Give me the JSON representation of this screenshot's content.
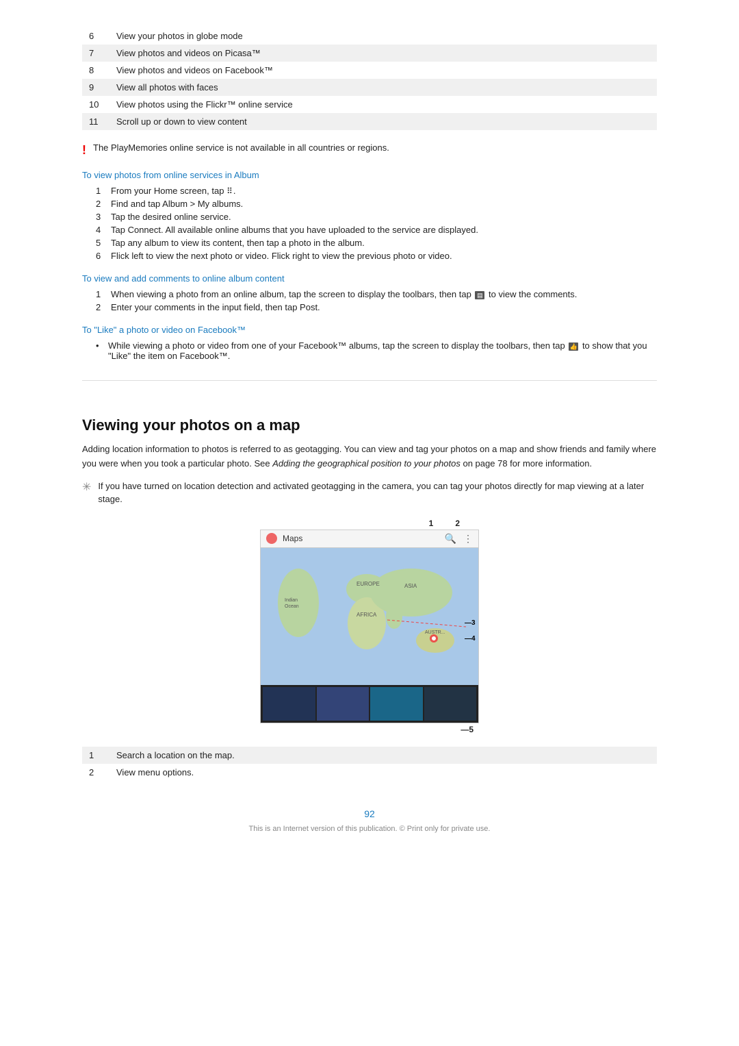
{
  "table_rows": [
    {
      "num": "6",
      "text": "View your photos in globe mode",
      "shaded": false
    },
    {
      "num": "7",
      "text": "View photos and videos on Picasa™",
      "shaded": true
    },
    {
      "num": "8",
      "text": "View photos and videos on Facebook™",
      "shaded": false
    },
    {
      "num": "9",
      "text": "View all photos with faces",
      "shaded": true
    },
    {
      "num": "10",
      "text": "View photos using the Flickr™ online service",
      "shaded": false
    },
    {
      "num": "11",
      "text": "Scroll up or down to view content",
      "shaded": true
    }
  ],
  "warning_note": "The PlayMemories online service is not available in all countries or regions.",
  "section1_heading": "To view photos from online services in Album",
  "section1_steps": [
    {
      "num": "1",
      "text": "From your Home screen, tap ⠿."
    },
    {
      "num": "2",
      "text": "Find and tap Album > My albums."
    },
    {
      "num": "3",
      "text": "Tap the desired online service."
    },
    {
      "num": "4",
      "text": "Tap Connect. All available online albums that you have uploaded to the service are displayed."
    },
    {
      "num": "5",
      "text": "Tap any album to view its content, then tap a photo in the album."
    },
    {
      "num": "6",
      "text": "Flick left to view the next photo or video. Flick right to view the previous photo or video."
    }
  ],
  "section2_heading": "To view and add comments to online album content",
  "section2_steps": [
    {
      "num": "1",
      "text": "When viewing a photo from an online album, tap the screen to display the toolbars, then tap  to view the comments."
    },
    {
      "num": "2",
      "text": "Enter your comments in the input field, then tap Post."
    }
  ],
  "section3_heading": "To \"Like\" a photo or video on Facebook™",
  "section3_bullets": [
    "While viewing a photo or video from one of your Facebook™ albums, tap the screen to display the toolbars, then tap  to show that you \"Like\" the item on Facebook™."
  ],
  "main_title": "Viewing your photos on a map",
  "main_para": "Adding location information to photos is referred to as geotagging. You can view and tag your photos on a map and show friends and family where you were when you took a particular photo. See Adding the geographical position to your photos on page 78 for more information.",
  "tip_text": "If you have turned on location detection and activated geotagging in the camera, you can tag your photos directly for map viewing at a later stage.",
  "map_toolbar_title": "Maps",
  "map_callouts": [
    {
      "num": "1",
      "label": "Search icon"
    },
    {
      "num": "2",
      "label": "Menu icon"
    },
    {
      "num": "3",
      "label": "Map line indicator"
    },
    {
      "num": "4",
      "label": "Location marker"
    },
    {
      "num": "5",
      "label": "Photo strip"
    }
  ],
  "callout_labels": [
    {
      "num": "1",
      "text": "Search a location on the map.",
      "shaded": true
    },
    {
      "num": "2",
      "text": "View menu options.",
      "shaded": false
    }
  ],
  "page_number": "92",
  "footer_text": "This is an Internet version of this publication. © Print only for private use."
}
